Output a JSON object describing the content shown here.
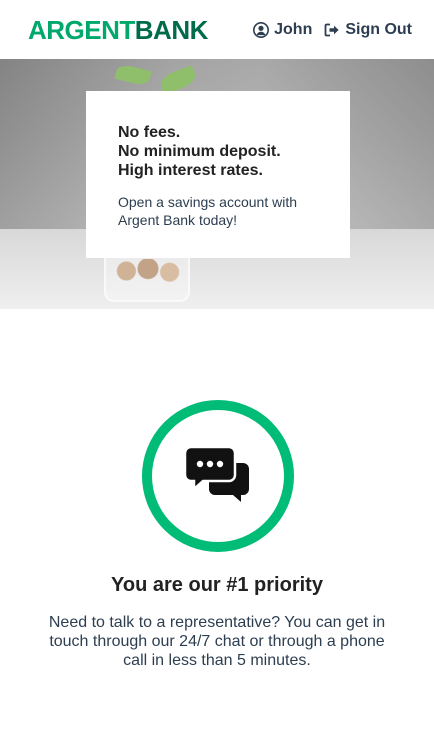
{
  "brand": {
    "name_part1": "ARGENT",
    "name_part2": "BANK"
  },
  "nav": {
    "user_label": "John",
    "signout_label": "Sign Out"
  },
  "hero": {
    "subtitles": [
      "No fees.",
      "No minimum deposit.",
      "High interest rates."
    ],
    "text": "Open a savings account with Argent Bank today!"
  },
  "feature": {
    "icon": "chat-icon",
    "title": "You are our #1 priority",
    "text": "Need to talk to a representative? You can get in touch through our 24/7 chat or through a phone call in less than 5 minutes."
  },
  "colors": {
    "brand_green": "#00bc77",
    "dark_green": "#006b4a",
    "text": "#2c3e50"
  }
}
